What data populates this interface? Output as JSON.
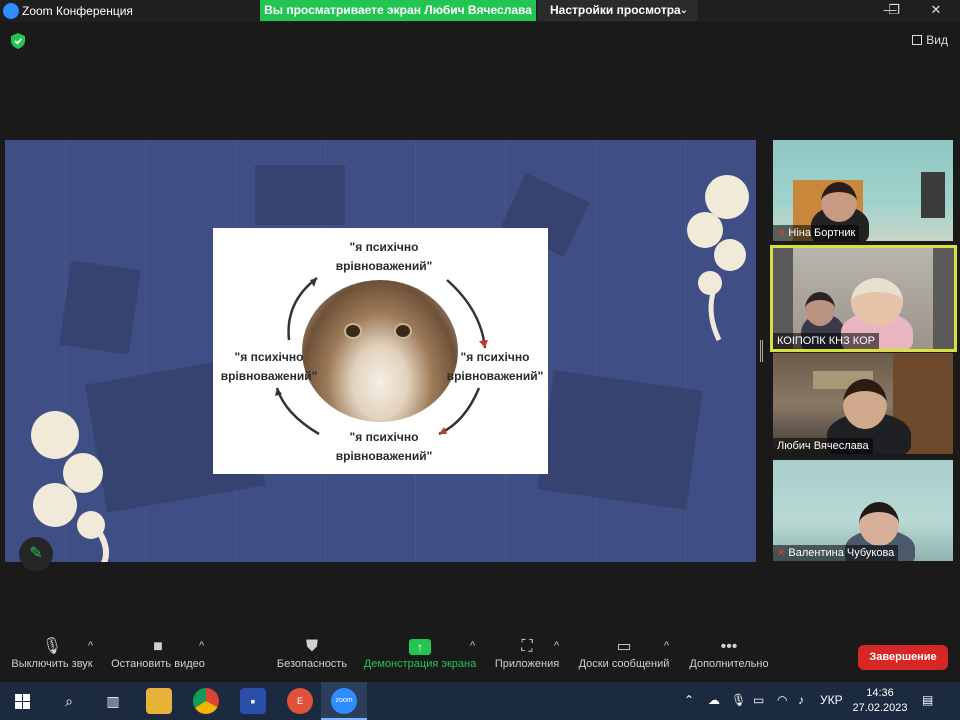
{
  "window": {
    "title": "Zoom Конференция",
    "minimize_icon": "minimize-icon",
    "maximize_icon": "restore-icon",
    "close_icon": "close-icon"
  },
  "banner": {
    "text": "Вы просматриваете экран Любич Вячеслава",
    "color": "#23C552"
  },
  "view_settings": {
    "label": "Настройки просмотра",
    "chevron": "˅"
  },
  "top_right": {
    "view_label": "Вид"
  },
  "slide": {
    "phrases": [
      "\"я психічно врівноважений\"",
      "\"я психічно врівноважений\"",
      "\"я психічно врівноважений\"",
      "\"я психічно врівноважений\""
    ],
    "background_color": "#3F4F85"
  },
  "participants": [
    {
      "name": "Ніна Бортник",
      "muted": true,
      "active": false
    },
    {
      "name": "КОІПОПК КНЗ КОР",
      "muted": false,
      "active": true
    },
    {
      "name": "Любич Вячеслава",
      "muted": false,
      "active": false
    },
    {
      "name": "Валентина Чубукова",
      "muted": true,
      "active": false
    }
  ],
  "toolbar": {
    "mute_label": "Выключить звук",
    "video_label": "Остановить видео",
    "security_label": "Безопасность",
    "share_label": "Демонстрация экрана",
    "apps_label": "Приложения",
    "whiteboards_label": "Доски сообщений",
    "more_label": "Дополнительно",
    "end_label": "Завершение",
    "more_glyph": "•••",
    "caret": "^"
  },
  "taskbar": {
    "language": "УКР",
    "time": "14:36",
    "date": "27.02.2023",
    "zoom_icon_text": "zoom",
    "chrome_badge": "E"
  },
  "colors": {
    "accent_green": "#23C552",
    "end_red": "#D72626",
    "active_speaker": "#D6E33C",
    "taskbar": "#1B2A3F"
  }
}
